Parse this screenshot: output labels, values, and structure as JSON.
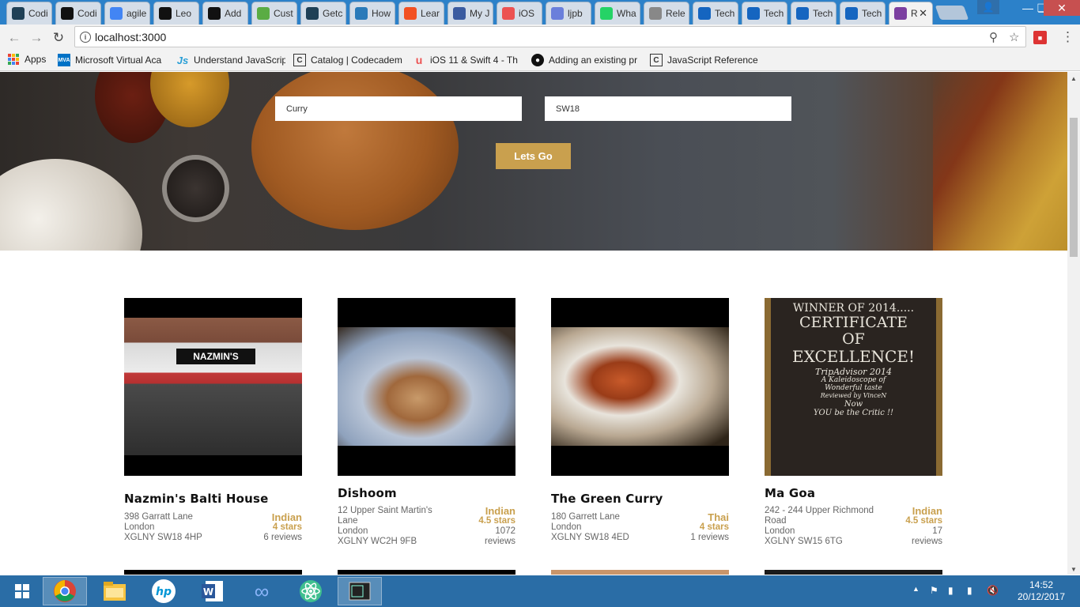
{
  "browser": {
    "tabs": [
      {
        "title": "Codi",
        "icon": "codecademy-icon",
        "color": "#1f4056"
      },
      {
        "title": "Codi",
        "icon": "github-icon",
        "color": "#111111"
      },
      {
        "title": "agile",
        "icon": "google-icon",
        "color": "#4285f4"
      },
      {
        "title": "Leo",
        "icon": "github-icon",
        "color": "#111111"
      },
      {
        "title": "Add",
        "icon": "github-icon",
        "color": "#111111"
      },
      {
        "title": "Cust",
        "icon": "trello-icon",
        "color": "#5aac44"
      },
      {
        "title": "Getc",
        "icon": "codecademy-icon",
        "color": "#1f4056"
      },
      {
        "title": "How",
        "icon": "compass-icon",
        "color": "#2a7ab9"
      },
      {
        "title": "Lear",
        "icon": "microsoft-icon",
        "color": "#f25022"
      },
      {
        "title": "My J",
        "icon": "journal-icon",
        "color": "#3a5ba0"
      },
      {
        "title": "iOS",
        "icon": "udemy-icon",
        "color": "#ec5252"
      },
      {
        "title": "ljpb",
        "icon": "mail-icon",
        "color": "#6a7fdb"
      },
      {
        "title": "Wha",
        "icon": "whatsapp-icon",
        "color": "#25d366"
      },
      {
        "title": "Rele",
        "icon": "document-icon",
        "color": "#888888"
      },
      {
        "title": "Tech",
        "icon": "x-icon",
        "color": "#1565c0"
      },
      {
        "title": "Tech",
        "icon": "x-icon",
        "color": "#1565c0"
      },
      {
        "title": "Tech",
        "icon": "x-icon",
        "color": "#1565c0"
      },
      {
        "title": "Tech",
        "icon": "x-icon",
        "color": "#1565c0"
      },
      {
        "title": "R",
        "icon": "restaurant-app-icon",
        "color": "#7b3fa0",
        "active": true
      }
    ],
    "url": "localhost:3000",
    "bookmarks": [
      {
        "label": "Apps",
        "icon": "apps-grid-icon"
      },
      {
        "label": "Microsoft Virtual Aca",
        "icon": "mva-icon"
      },
      {
        "label": "Understand JavaScrip",
        "icon": "js-icon"
      },
      {
        "label": "Catalog | Codecadem",
        "icon": "codecademy-icon"
      },
      {
        "label": "iOS 11 & Swift 4 - Th",
        "icon": "udemy-icon"
      },
      {
        "label": "Adding an existing pr",
        "icon": "github-icon"
      },
      {
        "label": "JavaScript Reference",
        "icon": "codecademy-icon"
      }
    ]
  },
  "search": {
    "food_value": "Curry",
    "location_value": "SW18",
    "button_label": "Lets Go"
  },
  "restaurants": [
    {
      "name": "Nazmin's Balti House",
      "address": [
        "398 Garratt Lane",
        "London",
        "XGLNY SW18 4HP"
      ],
      "cuisine": "Indian",
      "stars": "4 stars",
      "reviews": "6 reviews",
      "sign": "NAZMIN'S"
    },
    {
      "name": "Dishoom",
      "address": [
        "12 Upper Saint Martin's",
        "Lane",
        "London",
        "XGLNY WC2H 9FB"
      ],
      "cuisine": "Indian",
      "stars": "4.5 stars",
      "reviews": [
        "1072",
        "reviews"
      ]
    },
    {
      "name": "The Green Curry",
      "address": [
        "180 Garrett Lane",
        "London",
        "XGLNY SW18 4ED"
      ],
      "cuisine": "Thai",
      "stars": "4 stars",
      "reviews": "1 reviews"
    },
    {
      "name": "Ma Goa",
      "address": [
        "242 - 244 Upper Richmond",
        "Road",
        "London",
        "XGLNY SW15 6TG"
      ],
      "cuisine": "Indian",
      "stars": "4.5 stars",
      "reviews": [
        "17",
        "reviews"
      ],
      "chalkboard": [
        "WINNER OF 2014.....",
        "CERTIFICATE",
        "OF",
        "EXCELLENCE!",
        "TripAdvisor  2014",
        "A Kaleidoscope of",
        "Wonderful taste",
        "Reviewed by VinceN",
        "Now",
        "YOU be the Critic !!"
      ]
    }
  ],
  "taskbar": {
    "items": [
      "windows-start-icon",
      "chrome-icon",
      "file-explorer-icon",
      "hp-icon",
      "word-icon",
      "infinity-app-icon",
      "atom-icon",
      "terminal-icon"
    ],
    "time": "14:52",
    "date": "20/12/2017"
  },
  "colors": {
    "accent_gold": "#c9a04e",
    "tab_strip": "#2c81c9",
    "taskbar": "#2a6da6"
  }
}
